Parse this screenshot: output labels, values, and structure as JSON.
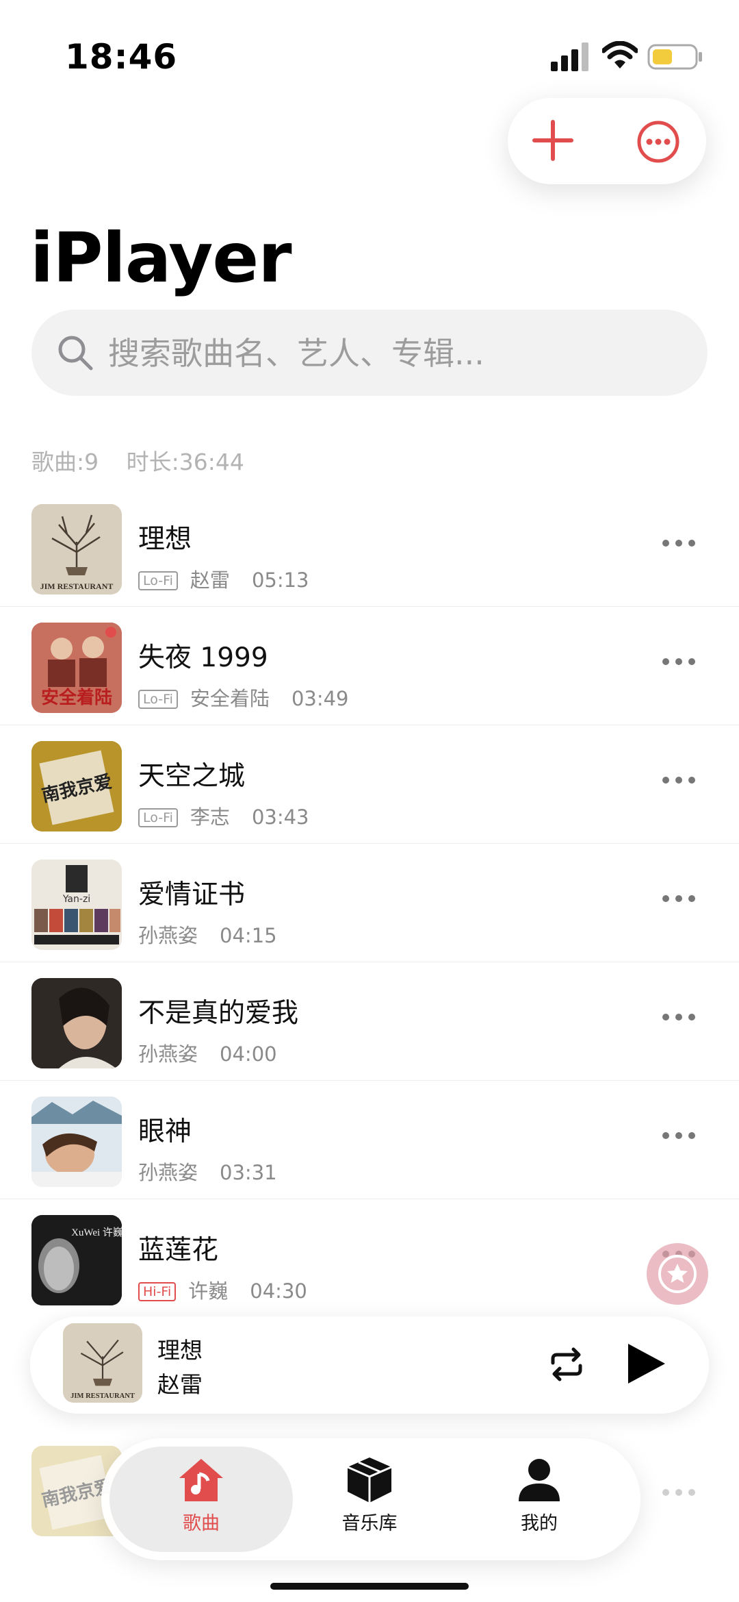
{
  "status": {
    "time": "18:46"
  },
  "header": {
    "title": "iPlayer"
  },
  "search": {
    "placeholder": "搜索歌曲名、艺人、专辑..."
  },
  "stats": {
    "songs": "歌曲:9",
    "duration": "时长:36:44"
  },
  "songs": [
    {
      "title": "理想",
      "quality": "Lo-Fi",
      "artist": "赵雷",
      "duration": "05:13"
    },
    {
      "title": "失夜 1999",
      "quality": "Lo-Fi",
      "artist": "安全着陆",
      "duration": "03:49"
    },
    {
      "title": "天空之城",
      "quality": "Lo-Fi",
      "artist": "李志",
      "duration": "03:43"
    },
    {
      "title": "爱情证书",
      "quality": "",
      "artist": "孙燕姿",
      "duration": "04:15"
    },
    {
      "title": "不是真的爱我",
      "quality": "",
      "artist": "孙燕姿",
      "duration": "04:00"
    },
    {
      "title": "眼神",
      "quality": "",
      "artist": "孙燕姿",
      "duration": "03:31"
    },
    {
      "title": "蓝莲花",
      "quality": "Hi-Fi",
      "artist": "许巍",
      "duration": "04:30"
    }
  ],
  "album_art_text": {
    "art1": "JIM RESTAURANT",
    "art2": "安全着陆",
    "art3": "南我京爱",
    "art4": "Yan-zi",
    "art7": "XuWei 许巍"
  },
  "now_playing": {
    "title": "理想",
    "artist": "赵雷"
  },
  "tabs": [
    {
      "label": "歌曲",
      "icon": "music-note-house-icon",
      "active": true
    },
    {
      "label": "音乐库",
      "icon": "cube-icon",
      "active": false
    },
    {
      "label": "我的",
      "icon": "person-icon",
      "active": false
    }
  ],
  "colors": {
    "accent": "#e14d4d",
    "text_secondary": "#8a8a8a"
  }
}
